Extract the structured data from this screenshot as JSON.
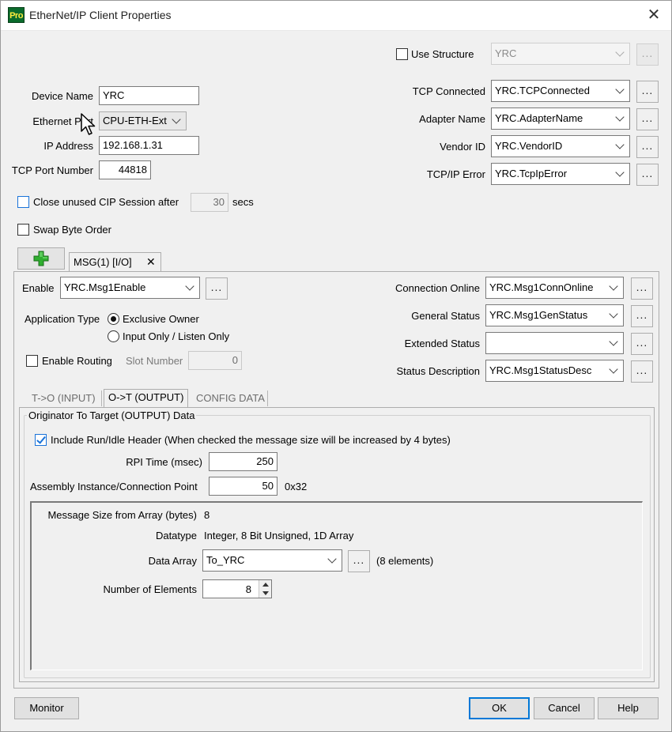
{
  "window": {
    "app_icon_text_a": "Pro",
    "title": "EtherNet/IP Client Properties",
    "close_glyph": "✕"
  },
  "device": {
    "name_label": "Device Name",
    "name_value": "YRC",
    "eth_port_label": "Ethernet Port",
    "eth_port_value": "CPU-ETH-Ext",
    "ip_label": "IP Address",
    "ip_value": "192.168.1.31",
    "tcp_port_label": "TCP Port Number",
    "tcp_port_value": "44818",
    "close_session_label": "Close unused CIP Session after",
    "close_session_value": "30",
    "close_session_unit": "secs",
    "swap_byte_label": "Swap Byte Order"
  },
  "structure": {
    "use_structure_label": "Use Structure",
    "use_structure_value": "YRC",
    "tcp_connected_label": "TCP Connected",
    "tcp_connected_value": "YRC.TCPConnected",
    "adapter_name_label": "Adapter Name",
    "adapter_name_value": "YRC.AdapterName",
    "vendor_id_label": "Vendor ID",
    "vendor_id_value": "YRC.VendorID",
    "tcpip_error_label": "TCP/IP Error",
    "tcpip_error_value": "YRC.TcpIpError",
    "dots": "..."
  },
  "msg_tabs": {
    "add_icon": "plus-icon",
    "tab_label": "MSG(1) [I/O]",
    "tab_close": "✕"
  },
  "msg": {
    "enable_label": "Enable",
    "enable_value": "YRC.Msg1Enable",
    "app_type_label": "Application Type",
    "exclusive_owner": "Exclusive Owner",
    "input_only": "Input Only / Listen Only",
    "enable_routing": "Enable Routing",
    "slot_number_label": "Slot Number",
    "slot_number_value": "0",
    "conn_online_label": "Connection Online",
    "conn_online_value": "YRC.Msg1ConnOnline",
    "gen_status_label": "General Status",
    "gen_status_value": "YRC.Msg1GenStatus",
    "ext_status_label": "Extended Status",
    "ext_status_value": "",
    "status_desc_label": "Status Description",
    "status_desc_value": "YRC.Msg1StatusDesc"
  },
  "io_tabs": {
    "input": "T->O (INPUT)",
    "output": "O->T (OUTPUT)",
    "config": "CONFIG DATA"
  },
  "output": {
    "group_title": "Originator To Target (OUTPUT) Data",
    "include_header_label": "Include Run/Idle Header (When checked the message size will be increased by 4 bytes)",
    "rpi_label": "RPI Time (msec)",
    "rpi_value": "250",
    "assembly_label": "Assembly Instance/Connection Point",
    "assembly_value": "50",
    "assembly_hex": "0x32",
    "msg_size_label": "Message Size from Array (bytes)",
    "msg_size_value": "8",
    "datatype_label": "Datatype",
    "datatype_value": "Integer, 8 Bit Unsigned, 1D Array",
    "data_array_label": "Data Array",
    "data_array_value": "To_YRC",
    "data_array_elements": "(8 elements)",
    "num_elements_label": "Number of Elements",
    "num_elements_value": "8"
  },
  "buttons": {
    "monitor": "Monitor",
    "ok": "OK",
    "cancel": "Cancel",
    "help": "Help"
  },
  "colors": {
    "accent": "#0078d7",
    "checkbox_blue": "#1a73d9",
    "add_green": "#2fae2f"
  }
}
